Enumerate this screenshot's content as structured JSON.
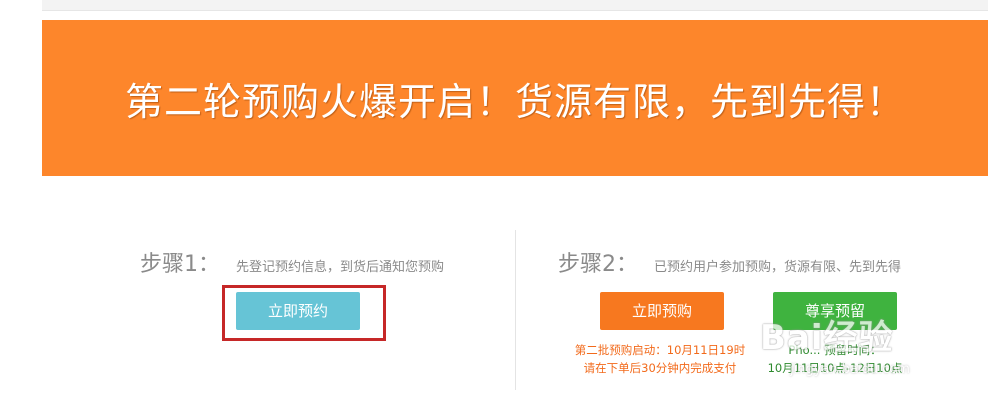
{
  "banner": {
    "title": "第二轮预购火爆开启！货源有限，先到先得！",
    "background_color": "#fd862b"
  },
  "step1": {
    "label": "步骤1：",
    "description": "先登记预约信息，到货后通知您预购",
    "button_label": "立即预约",
    "button_color": "#66c4d6",
    "highlight_color": "#c62828"
  },
  "step2": {
    "label": "步骤2：",
    "description": "已预约用户参加预购，货源有限、先到先得",
    "buy_button_label": "立即预购",
    "buy_button_color": "#f7781f",
    "buy_note_line1": "第二批预购启动：10月11日19时",
    "buy_note_line2": "请在下单后30分钟内完成支付",
    "vip_button_label": "尊享预留",
    "vip_button_color": "#3fb33f",
    "vip_note_line1": "Pho... 预留时间：",
    "vip_note_line2": "10月11日10点-12日10点"
  },
  "watermark": {
    "logo": "Bai经验",
    "domain": "jingyan.baidu.com"
  }
}
